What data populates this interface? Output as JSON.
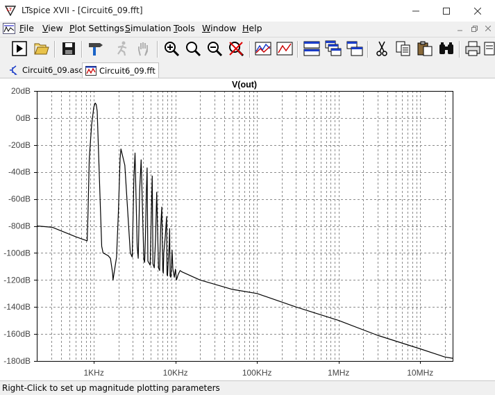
{
  "window": {
    "title": "LTspice XVII - [Circuit6_09.fft]"
  },
  "menu": [
    {
      "id": "file",
      "label": "File",
      "ul": "F",
      "rest": "ile"
    },
    {
      "id": "view",
      "label": "View",
      "ul": "V",
      "rest": "iew"
    },
    {
      "id": "plot-settings",
      "label": "Plot Settings",
      "ul": "P",
      "rest": "lot Settings"
    },
    {
      "id": "simulation",
      "label": "Simulation",
      "ul": "S",
      "rest": "imulation"
    },
    {
      "id": "tools",
      "label": "Tools",
      "ul": "T",
      "rest": "ools"
    },
    {
      "id": "window",
      "label": "Window",
      "ul": "W",
      "rest": "indow"
    },
    {
      "id": "help",
      "label": "Help",
      "ul": "H",
      "rest": "elp"
    }
  ],
  "toolbar": {
    "icons": [
      "run-icon",
      "open-folder-icon",
      "save-icon",
      "control-panel-hammer-icon",
      "halt-icon",
      "pan-hand-icon",
      "zoom-in-icon",
      "zoom-back-icon",
      "zoom-out-icon",
      "zoom-full-icon",
      "autorange-icon",
      "pick-traces-icon",
      "tile-horizontal-icon",
      "cascade-icon",
      "tile-vertical-icon",
      "cut-icon",
      "copy-icon",
      "paste-icon",
      "find-binoculars-icon",
      "print-icon",
      "print-preview-icon"
    ]
  },
  "tabs": [
    {
      "label": "Circuit6_09.asc",
      "icon": "schematic-icon",
      "active": false
    },
    {
      "label": "Circuit6_09.fft",
      "icon": "waveform-icon",
      "active": true
    }
  ],
  "status": {
    "text": "Right-Click to set up magnitude plotting parameters"
  },
  "chart_data": {
    "type": "line",
    "title": "V(out)",
    "x_scale": "log",
    "xlim": [
      200,
      25000000
    ],
    "ylim": [
      -180,
      20
    ],
    "y_ticks": [
      20,
      0,
      -20,
      -40,
      -60,
      -80,
      -100,
      -120,
      -140,
      -160,
      -180
    ],
    "y_tick_labels": [
      "20dB",
      "0dB",
      "-20dB",
      "-40dB",
      "-60dB",
      "-80dB",
      "-100dB",
      "-120dB",
      "-140dB",
      "-160dB",
      "-180dB"
    ],
    "x_ticks": [
      1000,
      10000,
      100000,
      1000000,
      10000000
    ],
    "x_tick_labels": [
      "1KHz",
      "10KHz",
      "100KHz",
      "1MHz",
      "10MHz"
    ],
    "grid": true,
    "series": [
      {
        "color": "#000000",
        "x": [
          200,
          310,
          600,
          830,
          850,
          880,
          940,
          1000,
          1040,
          1070,
          1100,
          1200,
          1250,
          1300,
          1500,
          1600,
          1700,
          1720,
          1900,
          2000,
          2100,
          2150,
          2400,
          2800,
          2950,
          3000,
          3100,
          3200,
          3400,
          3500,
          3600,
          3650,
          3800,
          4100,
          4200,
          4300,
          4400,
          4500,
          4600,
          4900,
          5000,
          5100,
          5200,
          5300,
          5500,
          5700,
          5800,
          5900,
          6200,
          6400,
          6500,
          6600,
          6800,
          7000,
          7100,
          7200,
          7500,
          7800,
          7900,
          8000,
          8200,
          8400,
          8500,
          8600,
          8800,
          9000,
          9100,
          9300,
          9700,
          10000,
          10300,
          10800,
          11400,
          12000,
          20000,
          50000,
          100000,
          300000,
          1000000,
          3000000,
          10000000,
          20000000,
          25000000
        ],
        "y": [
          -80,
          -81,
          -88,
          -91,
          -70,
          -30,
          -5,
          8,
          11,
          10,
          5,
          -65,
          -95,
          -100,
          -102,
          -104,
          -115,
          -120,
          -103,
          -70,
          -30,
          -23,
          -35,
          -100,
          -103,
          -85,
          -44,
          -26,
          -95,
          -104,
          -70,
          -53,
          -31,
          -105,
          -107,
          -85,
          -55,
          -37,
          -106,
          -109,
          -85,
          -63,
          -43,
          -108,
          -111,
          -90,
          -72,
          -55,
          -111,
          -113,
          -95,
          -81,
          -66,
          -113,
          -115,
          -100,
          -88,
          -73,
          -116,
          -117,
          -105,
          -93,
          -82,
          -117,
          -118,
          -105,
          -98,
          -112,
          -118,
          -112,
          -120,
          -116,
          -113,
          -114,
          -120,
          -127,
          -130,
          -140,
          -150,
          -161,
          -171,
          -177,
          -178
        ]
      }
    ]
  }
}
